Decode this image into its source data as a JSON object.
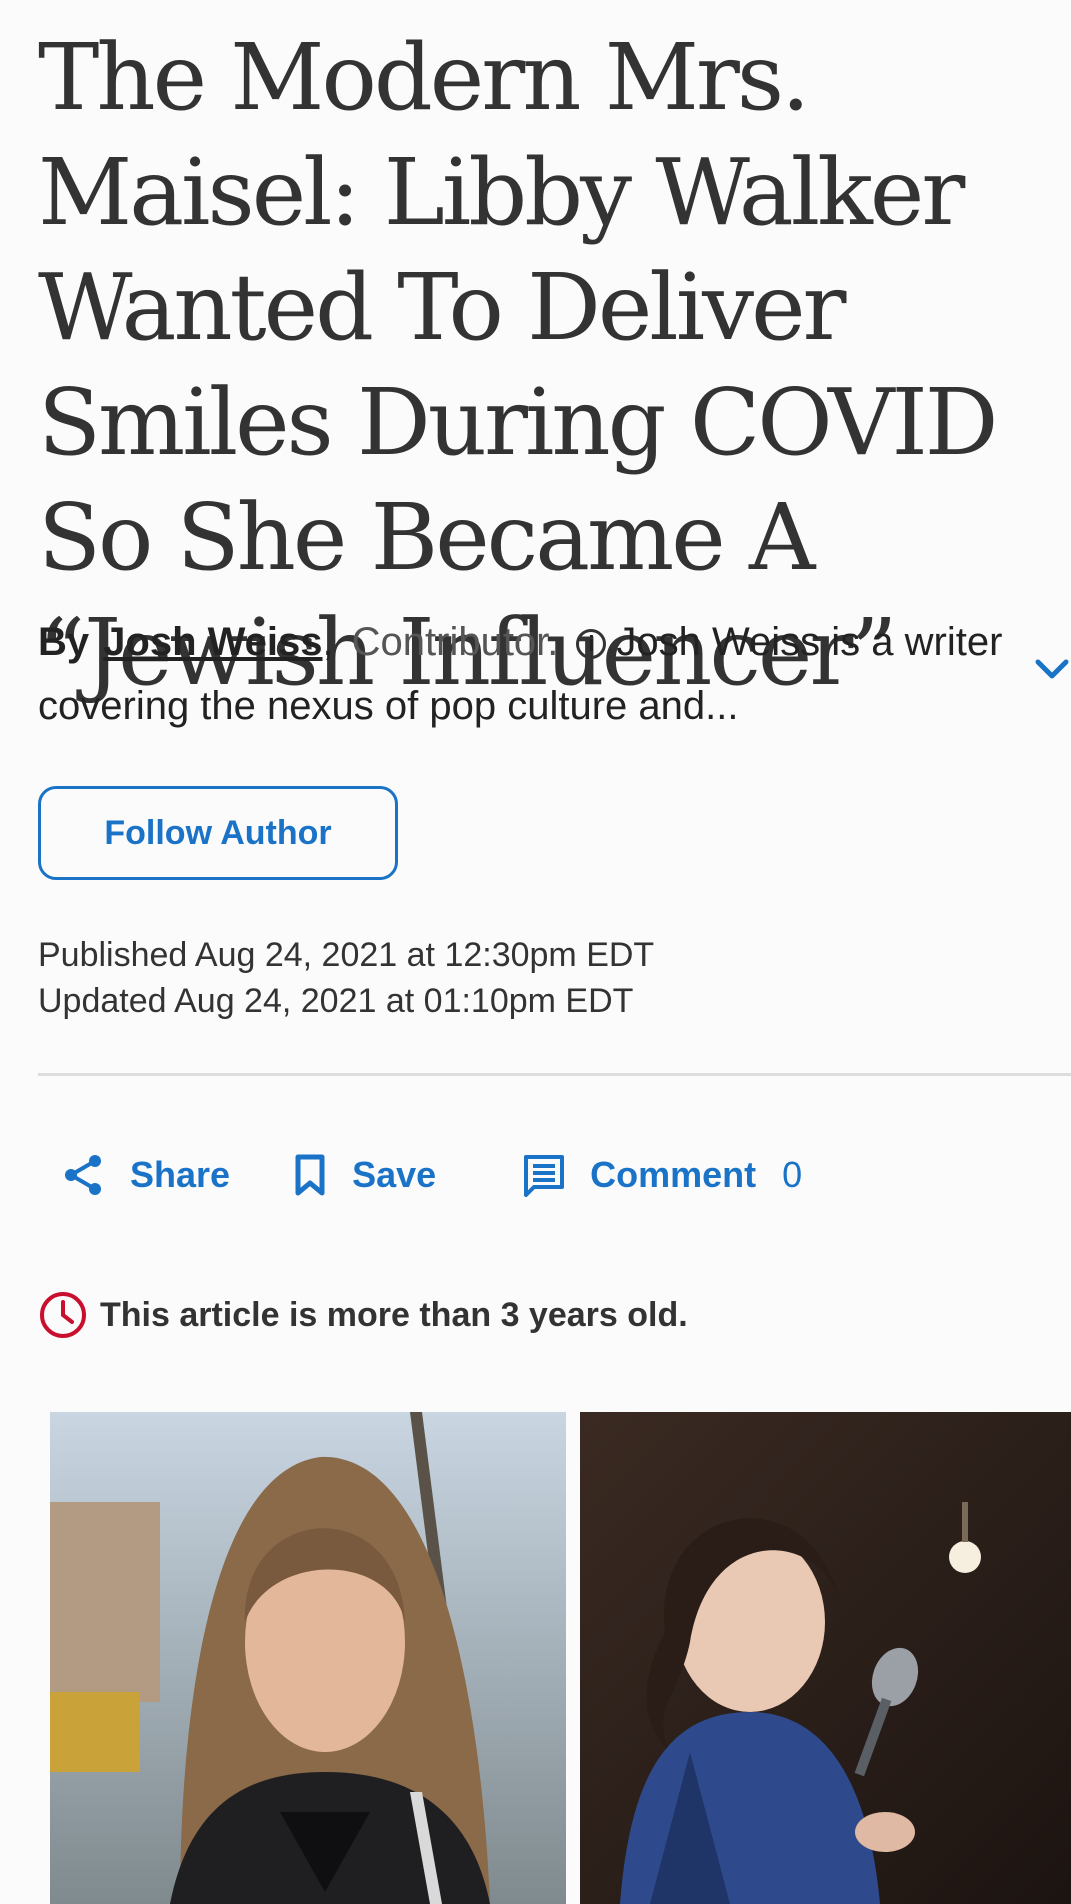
{
  "article": {
    "headline": "The Modern Mrs. Maisel: Libby Walker Wanted To Deliver Smiles During COVID So She Became A “Jewish Influencer”",
    "byline": {
      "by_label": "By",
      "author_name": "Josh Weiss",
      "role": "Contributor.",
      "bio_excerpt": "Josh Weiss is a writer covering the nexus of pop culture and..."
    },
    "follow_label": "Follow Author",
    "published": "Published Aug 24, 2021 at 12:30pm EDT",
    "updated": "Updated Aug 24, 2021 at 01:10pm EDT",
    "actions": {
      "share_label": "Share",
      "save_label": "Save",
      "comment_label": "Comment",
      "comment_count": "0"
    },
    "age_notice": "This article is more than 3 years old.",
    "hero_images": [
      {
        "icon": "photo-woman-outdoors"
      },
      {
        "icon": "photo-woman-microphone"
      }
    ]
  },
  "colors": {
    "accent_blue": "#1a73c7",
    "notice_red": "#c8102e",
    "text": "#333333"
  }
}
